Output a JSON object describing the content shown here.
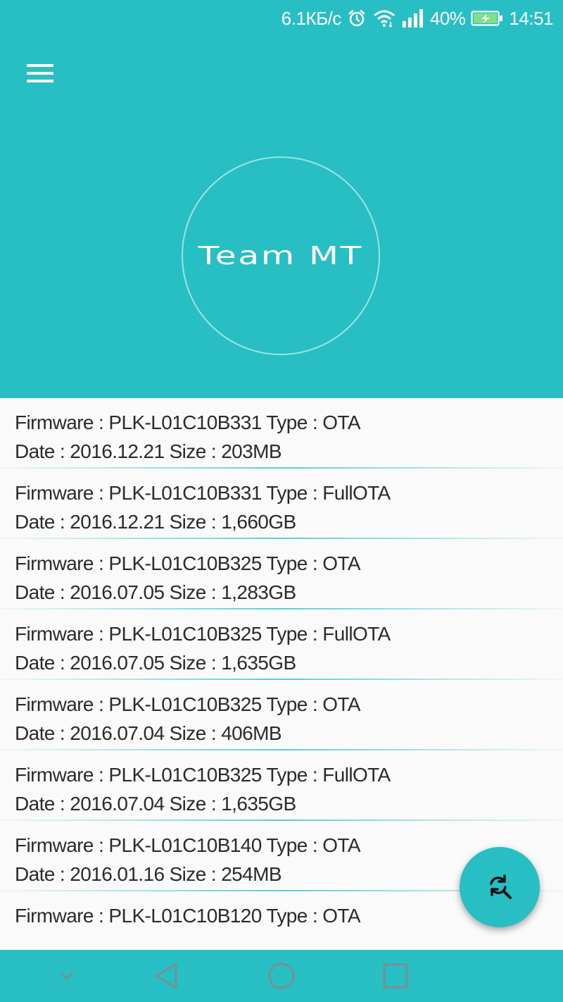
{
  "status_bar": {
    "net_speed": "6.1КБ/с",
    "battery_pct": "40%",
    "time": "14:51",
    "icons": [
      "alarm-icon",
      "wifi-icon",
      "signal-icon",
      "battery-charging-icon"
    ]
  },
  "header": {
    "menu_icon": "hamburger-menu-icon",
    "logo_text": "Team MT"
  },
  "firmware_list": [
    {
      "line1": "Firmware : PLK-L01C10B331 Type : OTA",
      "line2": "Date : 2016.12.21 Size : 203MB"
    },
    {
      "line1": "Firmware : PLK-L01C10B331 Type : FullOTA",
      "line2": "Date : 2016.12.21 Size : 1,660GB"
    },
    {
      "line1": "Firmware : PLK-L01C10B325 Type : OTA",
      "line2": "Date : 2016.07.05 Size : 1,283GB"
    },
    {
      "line1": "Firmware : PLK-L01C10B325 Type : FullOTA",
      "line2": "Date : 2016.07.05 Size : 1,635GB"
    },
    {
      "line1": "Firmware : PLK-L01C10B325 Type : OTA",
      "line2": "Date : 2016.07.04 Size : 406MB"
    },
    {
      "line1": "Firmware : PLK-L01C10B325 Type : FullOTA",
      "line2": "Date : 2016.07.04 Size : 1,635GB"
    },
    {
      "line1": "Firmware : PLK-L01C10B140 Type : OTA",
      "line2": "Date : 2016.01.16 Size : 254MB"
    },
    {
      "line1": "Firmware : PLK-L01C10B120 Type : OTA",
      "line2": ""
    }
  ],
  "fab": {
    "icon": "search-refresh-icon"
  },
  "nav_bar": {
    "icons": [
      "hide-nav-chevron-icon",
      "back-icon",
      "home-icon",
      "recents-icon"
    ]
  },
  "colors": {
    "accent": "#27bec4",
    "text": "#2b2b2b",
    "list_bg": "#fafafa"
  }
}
